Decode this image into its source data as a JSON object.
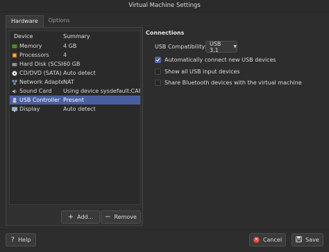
{
  "window": {
    "title": "Virtual Machine Settings"
  },
  "tabs": [
    {
      "label": "Hardware",
      "active": true
    },
    {
      "label": "Options",
      "active": false
    }
  ],
  "devices": {
    "columns": {
      "device": "Device",
      "summary": "Summary"
    },
    "rows": [
      {
        "icon": "memory-icon",
        "device": "Memory",
        "summary": "4 GB"
      },
      {
        "icon": "processor-icon",
        "device": "Processors",
        "summary": "4"
      },
      {
        "icon": "hard-disk-icon",
        "device": "Hard Disk (SCSI)",
        "summary": "60 GB"
      },
      {
        "icon": "cd-dvd-icon",
        "device": "CD/DVD (SATA)",
        "summary": "Auto detect"
      },
      {
        "icon": "network-icon",
        "device": "Network Adapter",
        "summary": "NAT"
      },
      {
        "icon": "sound-card-icon",
        "device": "Sound Card",
        "summary": "Using device sysdefault:CARD="
      },
      {
        "icon": "usb-icon",
        "device": "USB Controller",
        "summary": "Present",
        "selected": true
      },
      {
        "icon": "display-icon",
        "device": "Display",
        "summary": "Auto detect"
      }
    ],
    "add_label": "Add...",
    "remove_label": "Remove"
  },
  "connections": {
    "title": "Connections",
    "compat_label": "USB Compatibility:",
    "compat_value": "USB 3.1",
    "options": [
      {
        "label": "Automatically connect new USB devices",
        "checked": true
      },
      {
        "label": "Show all USB input devices",
        "checked": false
      },
      {
        "label": "Share Bluetooth devices with the virtual machine",
        "checked": false
      }
    ]
  },
  "footer": {
    "help_label": "Help",
    "cancel_label": "Cancel",
    "save_label": "Save"
  },
  "colors": {
    "accent": "#4a5fa0",
    "background": "#2d2d2d",
    "cancel_icon": "#e0443e"
  }
}
